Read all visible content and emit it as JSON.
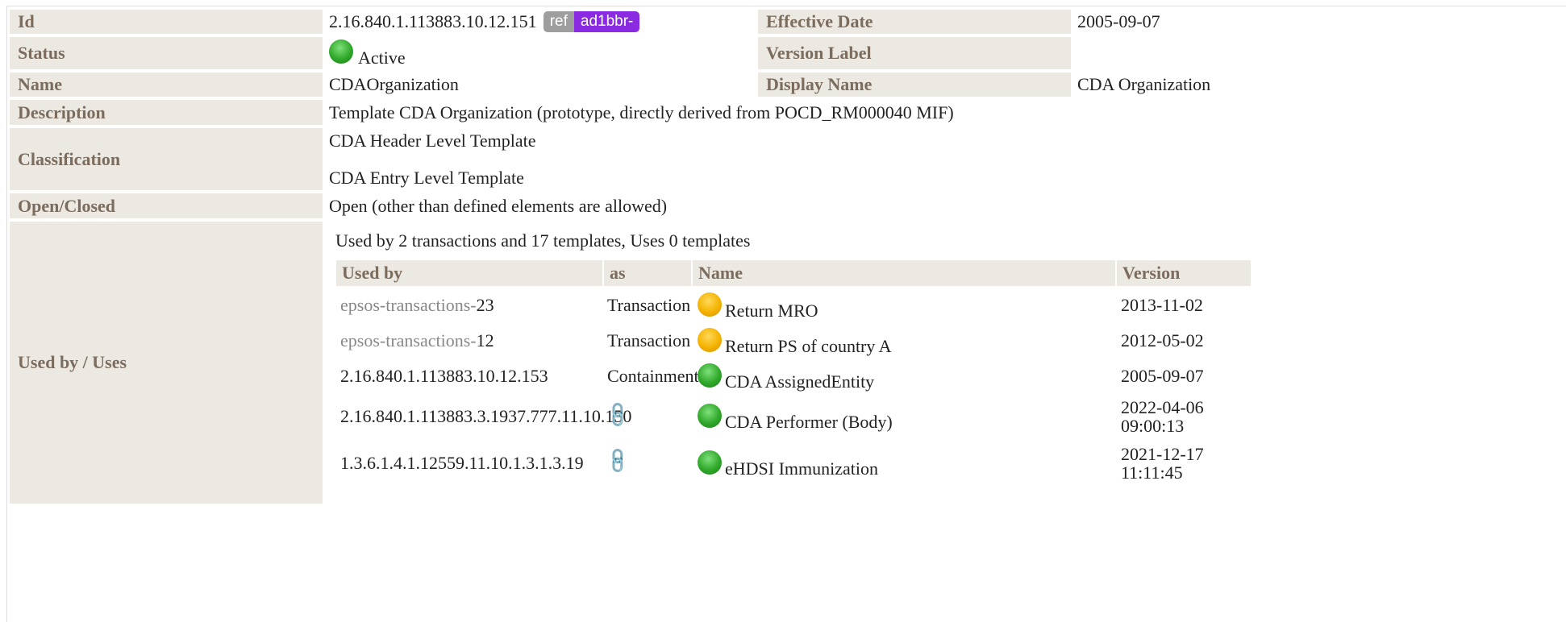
{
  "details": {
    "id_label": "Id",
    "id_value": "2.16.840.1.113883.10.12.151",
    "ref_badge": "ref",
    "ref_prefix": "ad1bbr-",
    "effective_date_label": "Effective Date",
    "effective_date_value": "2005-09-07",
    "status_label": "Status",
    "status_value": "Active",
    "version_label_label": "Version Label",
    "version_label_value": "",
    "name_label": "Name",
    "name_value": "CDAOrganization",
    "display_name_label": "Display Name",
    "display_name_value": "CDA Organization",
    "description_label": "Description",
    "description_value": "Template CDA Organization (prototype, directly derived from POCD_RM000040 MIF)",
    "classification_label": "Classification",
    "classification_values": [
      "CDA Header Level Template",
      "CDA Entry Level Template"
    ],
    "open_closed_label": "Open/Closed",
    "open_closed_value": "Open (other than defined elements are allowed)",
    "used_by_label": "Used by / Uses"
  },
  "usage": {
    "summary": "Used by 2 transactions and 17 templates, Uses 0 templates",
    "headers": [
      "Used by",
      "as",
      "Name",
      "Version"
    ],
    "rows": [
      {
        "used_by_prefix": "epsos-transactions-",
        "used_by_num": "23",
        "as": "Transaction",
        "status": "yellow",
        "name": "Return MRO",
        "version": "2013-11-02",
        "version2": ""
      },
      {
        "used_by_prefix": "epsos-transactions-",
        "used_by_num": "12",
        "as": "Transaction",
        "status": "yellow",
        "name": "Return PS of country A",
        "version": "2012-05-02",
        "version2": ""
      },
      {
        "used_by_prefix": "",
        "used_by_num": "2.16.840.1.113883.10.12.153",
        "as": "Containment",
        "status": "green",
        "name": "CDA AssignedEntity",
        "version": "2005-09-07",
        "version2": ""
      },
      {
        "used_by_prefix": "",
        "used_by_num": "2.16.840.1.113883.3.1937.777.11.10.150",
        "as": "link-icon",
        "status": "green",
        "name": "CDA Performer (Body)",
        "version": "2022-04-06",
        "version2": "09:00:13"
      },
      {
        "used_by_prefix": "",
        "used_by_num": "1.3.6.1.4.1.12559.11.10.1.3.1.3.19",
        "as": "link-icon",
        "status": "green",
        "name": "eHDSI Immunization",
        "version": "2021-12-17",
        "version2": "11:11:45"
      }
    ]
  },
  "colors": {
    "label_bg": "#ece8e2",
    "label_text": "#7b6c5d",
    "ref_badge": "#9e9e9e",
    "id_badge": "#8a2be2",
    "status_active": "#2fa82a",
    "status_draft": "#f4b300"
  }
}
